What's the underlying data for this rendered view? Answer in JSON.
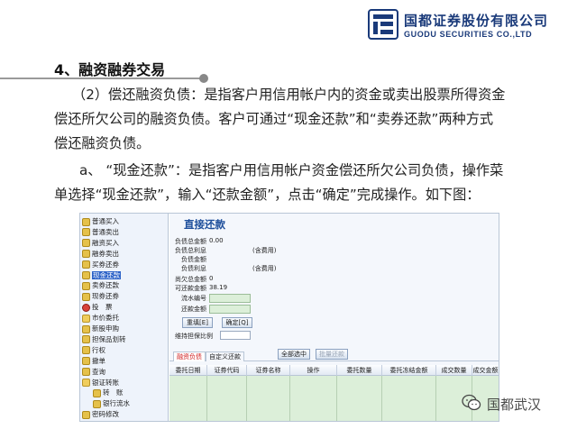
{
  "brand": {
    "name_cn": "国都证券股份有限公司",
    "name_en": "GUODU SECURITIES CO.,LTD",
    "color": "#1a3a7a"
  },
  "section": {
    "title": "4、融资融券交易"
  },
  "paragraph1": [
    "（2）偿还融资负债：是指客户用信用帐户内的资金或卖出股票所得资金",
    "偿还所欠公司的融资负债。客户可通过“现金还款”和“卖券还款”两种方式",
    "偿还融资负债。"
  ],
  "paragraph2": [
    "a、 “现金还款”：是指客户用信用帐户资金偿还所欠公司负债，操作菜",
    "单选择“现金还款”，输入“还款金额”，点击“确定”完成操作。如下图："
  ],
  "screenshot": {
    "menu": [
      {
        "label": "普通买入",
        "icon": "doc-icon"
      },
      {
        "label": "普通卖出",
        "icon": "doc-icon"
      },
      {
        "label": "融资买入",
        "icon": "doc-icon"
      },
      {
        "label": "融券卖出",
        "icon": "doc-icon"
      },
      {
        "label": "买券还券",
        "icon": "doc-icon"
      },
      {
        "label": "现金还款",
        "icon": "doc-icon",
        "selected": true
      },
      {
        "label": "卖券还款",
        "icon": "doc-icon"
      },
      {
        "label": "现券还券",
        "icon": "doc-icon"
      },
      {
        "label": "投　票",
        "icon": "vote-icon"
      },
      {
        "label": "市价委托",
        "icon": "folder-icon"
      },
      {
        "label": "新股申购",
        "icon": "doc-icon"
      },
      {
        "label": "担保品划转",
        "icon": "doc-icon"
      },
      {
        "label": "行权",
        "icon": "doc-icon"
      },
      {
        "label": "撤单",
        "icon": "doc-icon"
      },
      {
        "label": "查询",
        "icon": "doc-icon"
      },
      {
        "label": "银证转账",
        "icon": "folder-icon"
      },
      {
        "label": "转　账",
        "icon": "doc-icon",
        "sub": true
      },
      {
        "label": "银行流水",
        "icon": "doc-icon",
        "sub": true
      },
      {
        "label": "密码修改",
        "icon": "doc-icon"
      }
    ],
    "main": {
      "title": "直接还款",
      "fields": {
        "total_debt_label": "负债总金额",
        "total_debt_value": "0.00",
        "debt_total_interest_label": "负债总利息",
        "debt_total_interest_note": "(含费用)",
        "debt_amount_label": "负债金额",
        "debt_interest_label": "负债利息",
        "debt_interest_note": "(含费用)",
        "unsettled_label": "尚欠总金额",
        "unsettled_value": "0",
        "repayable_label": "可还款金额",
        "repayable_value": "38.19",
        "serial_label": "流水编号",
        "amount_label": "还款金额"
      },
      "buttons": {
        "refill": "重填[E]",
        "confirm": "确定[Q]"
      },
      "maintain_ratio_label": "维持担保比例",
      "tabs": [
        "融资负债",
        "自定义还款"
      ],
      "select_all": "全部选中",
      "batch_repay": "批量还款",
      "columns": [
        "委托日期",
        "证券代码",
        "证券名称",
        "操作",
        "委托数量",
        "委托冻结金额",
        "成交数量",
        "成交金额"
      ]
    }
  },
  "watermark": {
    "text": "国都武汉"
  }
}
